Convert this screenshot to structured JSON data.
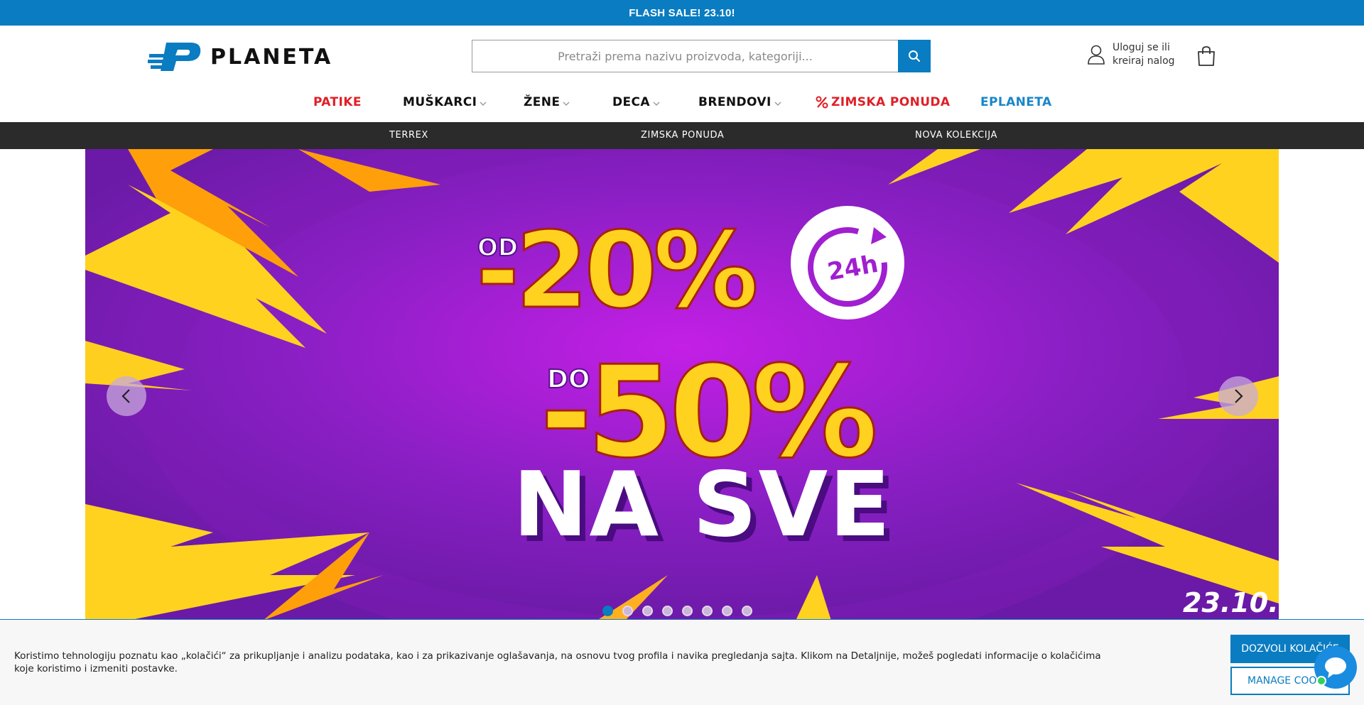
{
  "topbar": {
    "text": "FLASH SALE! 23.10!"
  },
  "brand": {
    "name": "PLANETA",
    "color": "#0a7cc1"
  },
  "search": {
    "placeholder": "Pretraži prema nazivu proizvoda, kategoriji...",
    "icon": "search-icon"
  },
  "account": {
    "line1": "Uloguj se ili",
    "line2": "kreiraj nalog",
    "icon": "user-icon"
  },
  "cart": {
    "icon": "cart-icon"
  },
  "nav": {
    "items": [
      {
        "label": "PATIKE",
        "dropdown": false,
        "color": "#e01f26"
      },
      {
        "label": "MUŠKARCI",
        "dropdown": true
      },
      {
        "label": "ŽENE",
        "dropdown": true
      },
      {
        "label": "DECA",
        "dropdown": true
      },
      {
        "label": "BRENDOVI",
        "dropdown": true
      },
      {
        "label": "ZIMSKA PONUDA",
        "dropdown": false,
        "color": "#e01f26",
        "icon": "percent-icon"
      },
      {
        "label": "EPLANETA",
        "dropdown": false,
        "color": "#1a86c8"
      }
    ]
  },
  "subnav": {
    "items": [
      "TERREX",
      "ZIMSKA PONUDA",
      "NOVA KOLEKCIJA"
    ]
  },
  "banner": {
    "line1_prefix": "OD",
    "line1_value": "-20%",
    "badge": "24h",
    "line2_prefix": "DO",
    "line2_value": "-50%",
    "line3": "NA SVE",
    "date": "23.10.",
    "slide_count": 8,
    "active_slide": 1,
    "colors": {
      "background": "#8a1fc4",
      "accent": "#ffd21f",
      "bolt_orange": "#ff9f0a"
    }
  },
  "cookie": {
    "text": "Koristimo tehnologiju poznatu kao „kolačići“ za prikupljanje i analizu podataka, kao i za prikazivanje oglašavanja, na osnovu tvog profila i navika pregledanja sajta. Klikom na Detaljnije, možeš pogledati informacije o kolačićima koje koristimo i izmeniti postavke.",
    "allow_label": "DOZVOLI KOLAČIĆE",
    "manage_label": "MANAGE COOKIES"
  }
}
